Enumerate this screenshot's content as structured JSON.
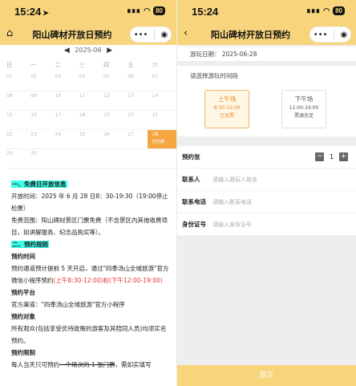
{
  "left": {
    "status": {
      "time": "15:24",
      "signal": "∎∎∎",
      "battery": "80"
    },
    "navbar": {
      "title": "阳山碑材开放日预约",
      "more": "•••",
      "record": "◉"
    },
    "calendar": {
      "month": "2025-06",
      "weekdays": [
        "日",
        "一",
        "二",
        "三",
        "四",
        "五",
        "六"
      ],
      "rows": [
        [
          "01",
          "02",
          "03",
          "04",
          "05",
          "06",
          "07"
        ],
        [
          "08",
          "09",
          "10",
          "11",
          "12",
          "13",
          "14"
        ],
        [
          "15",
          "16",
          "17",
          "18",
          "19",
          "20",
          "21"
        ],
        [
          "22",
          "23",
          "24",
          "25",
          "26",
          "27",
          "28"
        ],
        [
          "29",
          "30",
          "",
          "",
          "",
          "",
          ""
        ]
      ],
      "selected_sub": "已约满"
    },
    "info": {
      "h1": "一、免费日开放信息",
      "open_time": "开放时间：2025 年 6 月 28 日8：30-19:30（19:00停止检票）",
      "free_scope": "免费范围：阳山碑材景区门票免费（不含景区内其他收费项目，如讲解服务、纪念品购买等）。",
      "h2": "二、预约规则",
      "t1": "预约时间",
      "p1a": "预约通道预计提前 5 天开启，通过\"四季汤山全域旅游\"官方微信小程序预约",
      "p1b": "(上午8:30-12:00)和(下午12:00-19:00)",
      "t2": "预约平台",
      "p2": "官方渠道：\"四季汤山全域旅游\"官方小程序",
      "t3": "预约对象",
      "p3": "所有观众(包括享受优待政策的游客及其陪同人员)均须实名预约。",
      "t4": "预约限制",
      "p4a": "每人当天只可预约",
      "p4b": "一个场次的 1 张门票",
      "p4c": "，需如实填写"
    }
  },
  "right": {
    "status": {
      "time": "15:24",
      "signal": "∎∎∎",
      "battery": "80"
    },
    "navbar": {
      "back": "‹",
      "title": "阳山碑材开放日预约",
      "more": "•••",
      "record": "◉"
    },
    "date_label": "游玩日期：",
    "date_value": "2025-06-28",
    "slot_label": "请选择游玩时间段",
    "slots": [
      {
        "name": "上午场",
        "time": "8:30-12:00",
        "status": "已无票"
      },
      {
        "name": "下午场",
        "time": "12:00-19:00",
        "status": "票源充足"
      }
    ],
    "form": {
      "ticket_label": "预约张",
      "minus": "−",
      "qty": "1",
      "plus": "+",
      "contact_label": "联系人",
      "contact_placeholder": "请输入游玩人姓名",
      "phone_label": "联系电话",
      "phone_placeholder": "请输入联系电话",
      "id_label": "身份证号",
      "id_placeholder": "请输入身份证号"
    },
    "submit": "提交"
  },
  "colors": {
    "accent": "#f8d57d",
    "selected": "#f4a740",
    "highlight": "#39ffe8",
    "red": "#e53333"
  },
  "icons": {
    "home": "home-icon",
    "back": "back-icon",
    "more": "more-icon",
    "record": "record-icon"
  }
}
